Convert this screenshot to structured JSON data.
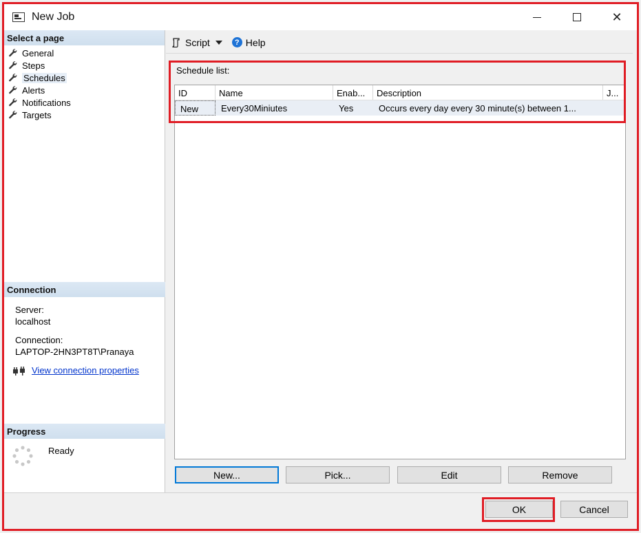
{
  "window": {
    "title": "New Job",
    "minimize_glyph": "—",
    "maximize_glyph": "☐",
    "close_glyph": "✕"
  },
  "sidebar": {
    "select_page_header": "Select a page",
    "pages": [
      {
        "label": "General",
        "icon": "wrench-icon",
        "selected": false
      },
      {
        "label": "Steps",
        "icon": "wrench-icon",
        "selected": false
      },
      {
        "label": "Schedules",
        "icon": "wrench-icon",
        "selected": true
      },
      {
        "label": "Alerts",
        "icon": "wrench-icon",
        "selected": false
      },
      {
        "label": "Notifications",
        "icon": "wrench-icon",
        "selected": false
      },
      {
        "label": "Targets",
        "icon": "wrench-icon",
        "selected": false
      }
    ],
    "connection_header": "Connection",
    "server_label": "Server:",
    "server_value": "localhost",
    "connection_label": "Connection:",
    "connection_value": "LAPTOP-2HN3PT8T\\Pranaya",
    "view_connection_link": "View connection properties",
    "progress_header": "Progress",
    "progress_status": "Ready"
  },
  "toolbar": {
    "script_label": "Script",
    "help_label": "Help",
    "help_glyph": "?"
  },
  "schedules": {
    "list_label": "Schedule list:",
    "columns": [
      "ID",
      "Name",
      "Enab...",
      "Description",
      "J..."
    ],
    "rows": [
      {
        "id": "New",
        "name": "Every30Miniutes",
        "enabled": "Yes",
        "description": "Occurs every day every 30 minute(s) between 1...",
        "jobs": ""
      }
    ],
    "buttons": {
      "new": "New...",
      "pick": "Pick...",
      "edit": "Edit",
      "remove": "Remove"
    }
  },
  "footer": {
    "ok": "OK",
    "cancel": "Cancel"
  },
  "colors": {
    "highlight_border": "#e01c24",
    "section_header": "#d6e4f2",
    "link": "#0033cc",
    "selected_row": "#e9eef5"
  }
}
